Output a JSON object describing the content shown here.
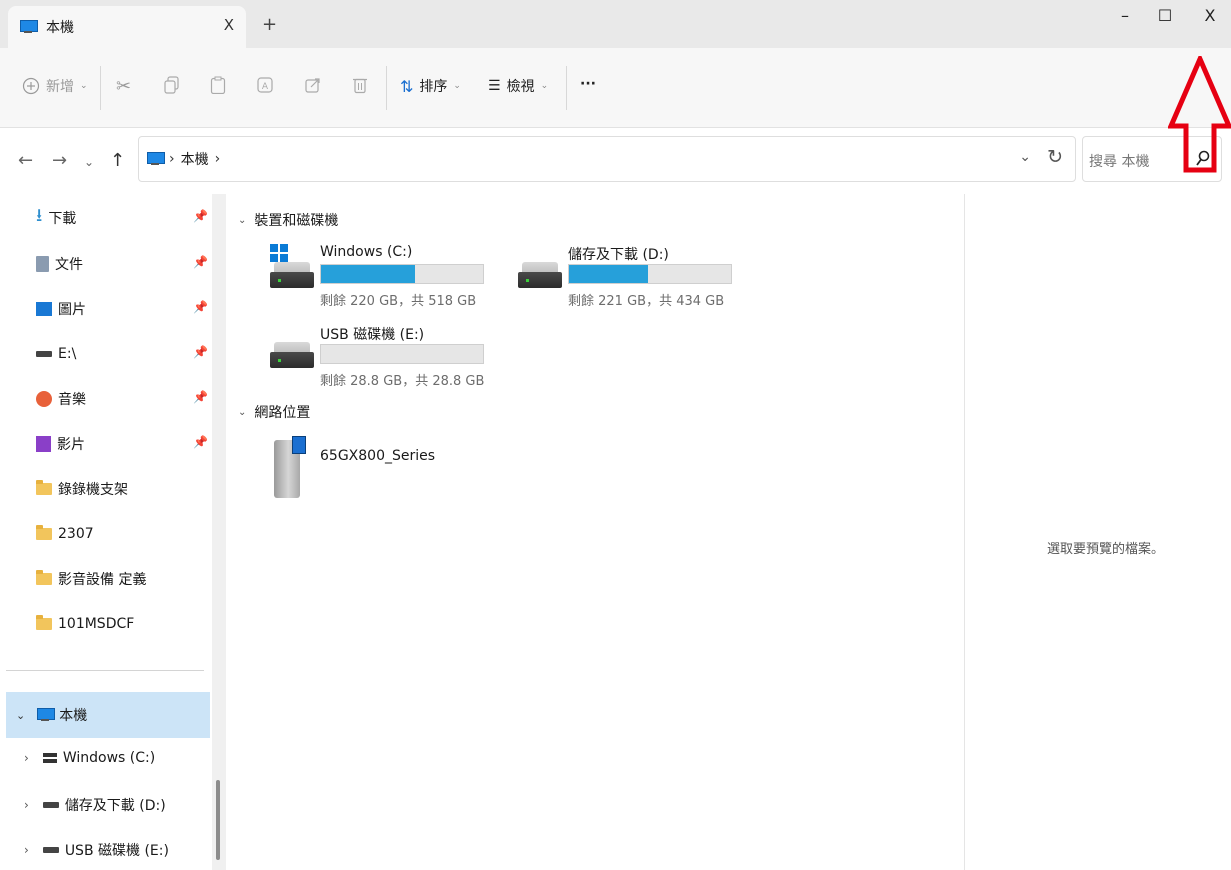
{
  "window": {
    "tab_title": "本機",
    "tab_close": "X",
    "new_tab": "+",
    "min": "–",
    "max": "☐",
    "close": "X"
  },
  "toolbar": {
    "new_label": "新增",
    "sort_label": "排序",
    "view_label": "檢視",
    "more_label": "···"
  },
  "address": {
    "crumb": "本機",
    "search_placeholder": "搜尋 本機"
  },
  "sidebar": {
    "quick": [
      {
        "label": "下載",
        "icon": "download-icon"
      },
      {
        "label": "文件",
        "icon": "documents-icon"
      },
      {
        "label": "圖片",
        "icon": "pictures-icon"
      },
      {
        "label": "E:\\",
        "icon": "drive-icon"
      },
      {
        "label": "音樂",
        "icon": "music-icon"
      },
      {
        "label": "影片",
        "icon": "video-icon"
      }
    ],
    "folders": [
      "錄錄機支架",
      "2307",
      "影音設備 定義",
      "101MSDCF"
    ],
    "this_pc": "本機",
    "drives": [
      "Windows (C:)",
      "儲存及下載 (D:)",
      "USB 磁碟機 (E:)"
    ]
  },
  "main": {
    "group_devices": "裝置和磁碟機",
    "group_network": "網路位置",
    "drives": [
      {
        "name": "Windows (C:)",
        "info": "剩餘 220 GB，共 518 GB",
        "used_fraction": 0.58
      },
      {
        "name": "儲存及下載 (D:)",
        "info": "剩餘 221 GB，共 434 GB",
        "used_fraction": 0.49
      },
      {
        "name": "USB 磁碟機 (E:)",
        "info": "剩餘 28.8 GB，共 28.8 GB",
        "used_fraction": 0.0
      }
    ],
    "network_device": "65GX800_Series"
  },
  "preview": {
    "message": "選取要預覽的檔案。"
  },
  "colors": {
    "accent": "#26a0da",
    "selection": "#cce4f7",
    "annotation": "#e60012"
  }
}
